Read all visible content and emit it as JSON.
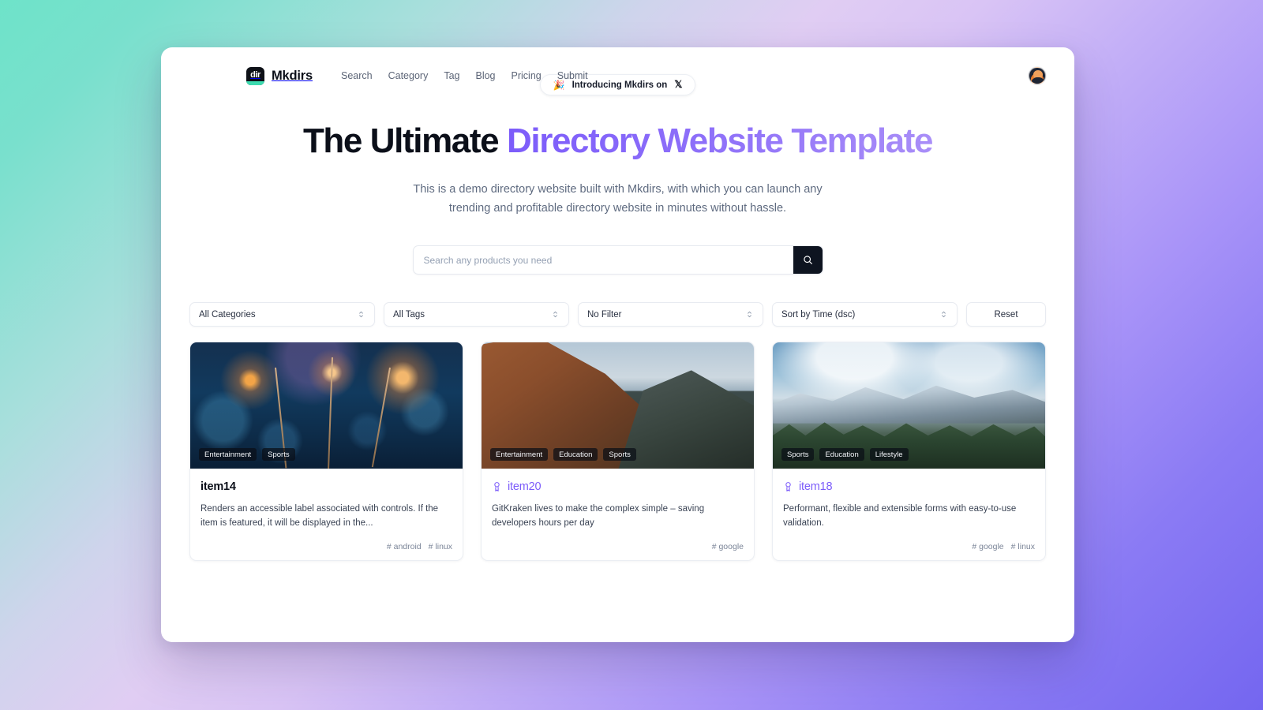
{
  "theme": {
    "accent": "#7c5cfa",
    "dark": "#0e1420",
    "logo_green": "#3ddbb0",
    "bg_gradient_from": "#6ee3c9",
    "bg_gradient_to": "#7466f0"
  },
  "navbar": {
    "brand": {
      "logo_text": "dir",
      "name": "Mkdirs"
    },
    "links": [
      {
        "label": "Search"
      },
      {
        "label": "Category"
      },
      {
        "label": "Tag"
      },
      {
        "label": "Blog"
      },
      {
        "label": "Pricing"
      },
      {
        "label": "Submit"
      }
    ],
    "avatar_alt": "user-avatar"
  },
  "hero": {
    "pill": {
      "emoji": "🎉",
      "text": "Introducing Mkdirs on",
      "platform": "𝕏"
    },
    "title_plain": "The Ultimate ",
    "title_accent": "Directory Website Template",
    "subtitle_line1": "This is a demo directory website built with Mkdirs, with which you can launch",
    "subtitle_line2": "any trending and profitable directory website in minutes without hassle."
  },
  "search": {
    "placeholder": "Search any products you need",
    "value": "",
    "button_icon": "search-icon"
  },
  "filters": {
    "selects": [
      {
        "name": "categories",
        "value": "All Categories"
      },
      {
        "name": "tags",
        "value": "All Tags"
      },
      {
        "name": "filter",
        "value": "No Filter"
      },
      {
        "name": "sort",
        "value": "Sort by Time (dsc)"
      }
    ],
    "reset_label": "Reset"
  },
  "cards": [
    {
      "art": "art-sparkler",
      "categories": [
        "Entertainment",
        "Sports"
      ],
      "title": "item14",
      "featured": false,
      "desc": "Renders an accessible label associated with controls. If the item is featured, it will be displayed in the...",
      "tags": [
        "# android",
        "# linux"
      ]
    },
    {
      "art": "art-ridge",
      "categories": [
        "Entertainment",
        "Education",
        "Sports"
      ],
      "title": "item20",
      "featured": true,
      "desc": "GitKraken lives to make the complex simple – saving developers hours per day",
      "tags": [
        "# google"
      ]
    },
    {
      "art": "art-alps",
      "categories": [
        "Sports",
        "Education",
        "Lifestyle"
      ],
      "title": "item18",
      "featured": true,
      "desc": "Performant, flexible and extensible forms with easy-to-use validation.",
      "tags": [
        "# google",
        "# linux"
      ]
    }
  ]
}
